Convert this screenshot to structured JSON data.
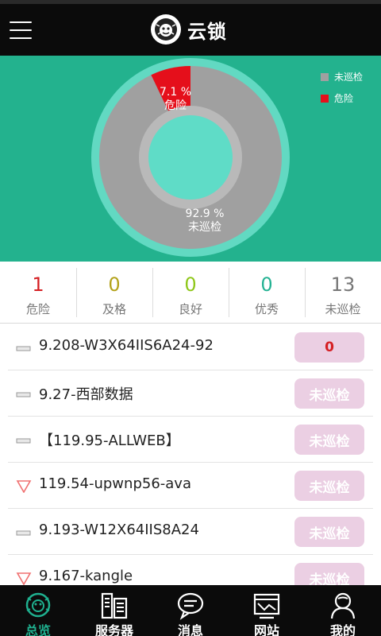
{
  "header": {
    "title": "云锁",
    "menu_icon": "hamburger-menu-icon",
    "logo_icon": "lion-logo-icon"
  },
  "chart_data": {
    "type": "pie",
    "donut": true,
    "slices": [
      {
        "name": "未巡检",
        "value": 92.9,
        "label": "92.9 %",
        "color": "#a0a0a0"
      },
      {
        "name": "危险",
        "value": 7.1,
        "label": "7.1 %",
        "color": "#e50f1b"
      }
    ],
    "legend": [
      {
        "label": "未巡检",
        "color": "#a0a0a0"
      },
      {
        "label": "危险",
        "color": "#e50f1b"
      }
    ],
    "legend_position": "top-right"
  },
  "stats": [
    {
      "value": "1",
      "label": "危险",
      "color": "#d51f23"
    },
    {
      "value": "0",
      "label": "及格",
      "color": "#b3a21a"
    },
    {
      "value": "0",
      "label": "良好",
      "color": "#8fc71a"
    },
    {
      "value": "0",
      "label": "优秀",
      "color": "#24b293"
    },
    {
      "value": "13",
      "label": "未巡检",
      "color": "#777777"
    }
  ],
  "servers": [
    {
      "name": "9.208-W3X64IIS6A24-92",
      "status": "0",
      "icon": "minus-icon",
      "status_color": "#d51f23"
    },
    {
      "name": "9.27-西部数据",
      "status": "未巡检",
      "icon": "minus-icon",
      "status_color": "#ffffff"
    },
    {
      "name": "【119.95-ALLWEB】",
      "status": "未巡检",
      "icon": "minus-icon",
      "status_color": "#ffffff"
    },
    {
      "name": "119.54-upwnp56-ava",
      "status": "未巡检",
      "icon": "down-triangle-icon",
      "status_color": "#ffffff"
    },
    {
      "name": "9.193-W12X64IIS8A24",
      "status": "未巡检",
      "icon": "minus-icon",
      "status_color": "#ffffff"
    },
    {
      "name": "9.167-kangle",
      "status": "未巡检",
      "icon": "down-triangle-icon",
      "status_color": "#ffffff"
    }
  ],
  "tabs": [
    {
      "label": "总览",
      "icon": "lion-overview-icon",
      "active": true
    },
    {
      "label": "服务器",
      "icon": "server-icon",
      "active": false
    },
    {
      "label": "消息",
      "icon": "message-bubble-icon",
      "active": false
    },
    {
      "label": "网站",
      "icon": "website-icon",
      "active": false
    },
    {
      "label": "我的",
      "icon": "user-icon",
      "active": false
    }
  ],
  "colors": {
    "accent": "#23b28e",
    "tab_active": "#1fb08f",
    "tab_inactive": "#ffffff"
  }
}
